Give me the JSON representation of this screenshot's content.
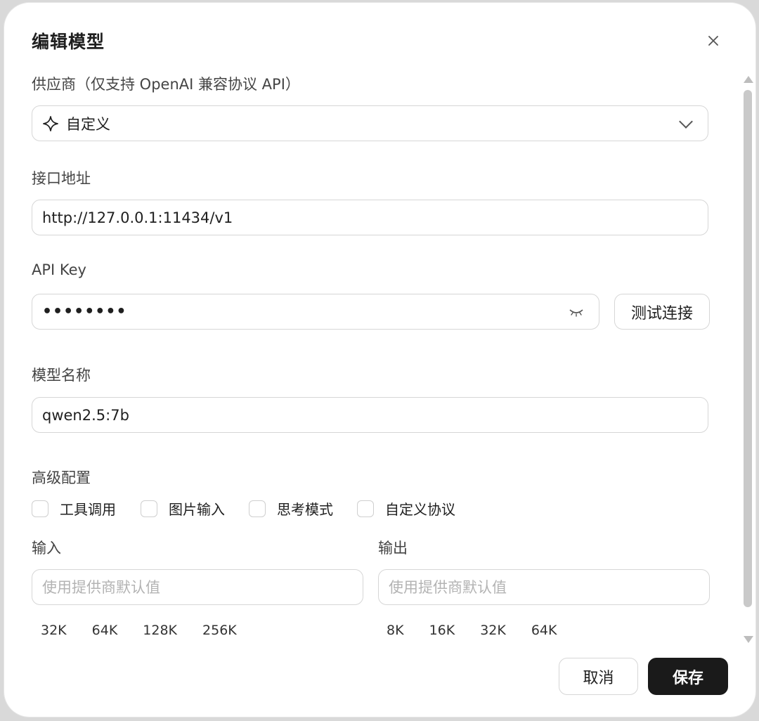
{
  "dialog": {
    "title": "编辑模型",
    "close_icon": "close-icon"
  },
  "provider": {
    "label": "供应商（仅支持 OpenAI 兼容协议 API）",
    "selected": "自定义",
    "icon": "sparkle-icon"
  },
  "endpoint": {
    "label": "接口地址",
    "value": "http://127.0.0.1:11434/v1"
  },
  "api_key": {
    "label": "API Key",
    "value": "••••••••",
    "test_button": "测试连接"
  },
  "model_name": {
    "label": "模型名称",
    "value": "qwen2.5:7b"
  },
  "advanced": {
    "label": "高级配置",
    "options": [
      {
        "label": "工具调用",
        "checked": false
      },
      {
        "label": "图片输入",
        "checked": false
      },
      {
        "label": "思考模式",
        "checked": false
      },
      {
        "label": "自定义协议",
        "checked": false
      }
    ]
  },
  "input_tokens": {
    "label": "输入",
    "placeholder": "使用提供商默认值",
    "presets": [
      "32K",
      "64K",
      "128K",
      "256K"
    ]
  },
  "output_tokens": {
    "label": "输出",
    "placeholder": "使用提供商默认值",
    "presets": [
      "8K",
      "16K",
      "32K",
      "64K"
    ]
  },
  "footer": {
    "cancel": "取消",
    "save": "保存"
  }
}
